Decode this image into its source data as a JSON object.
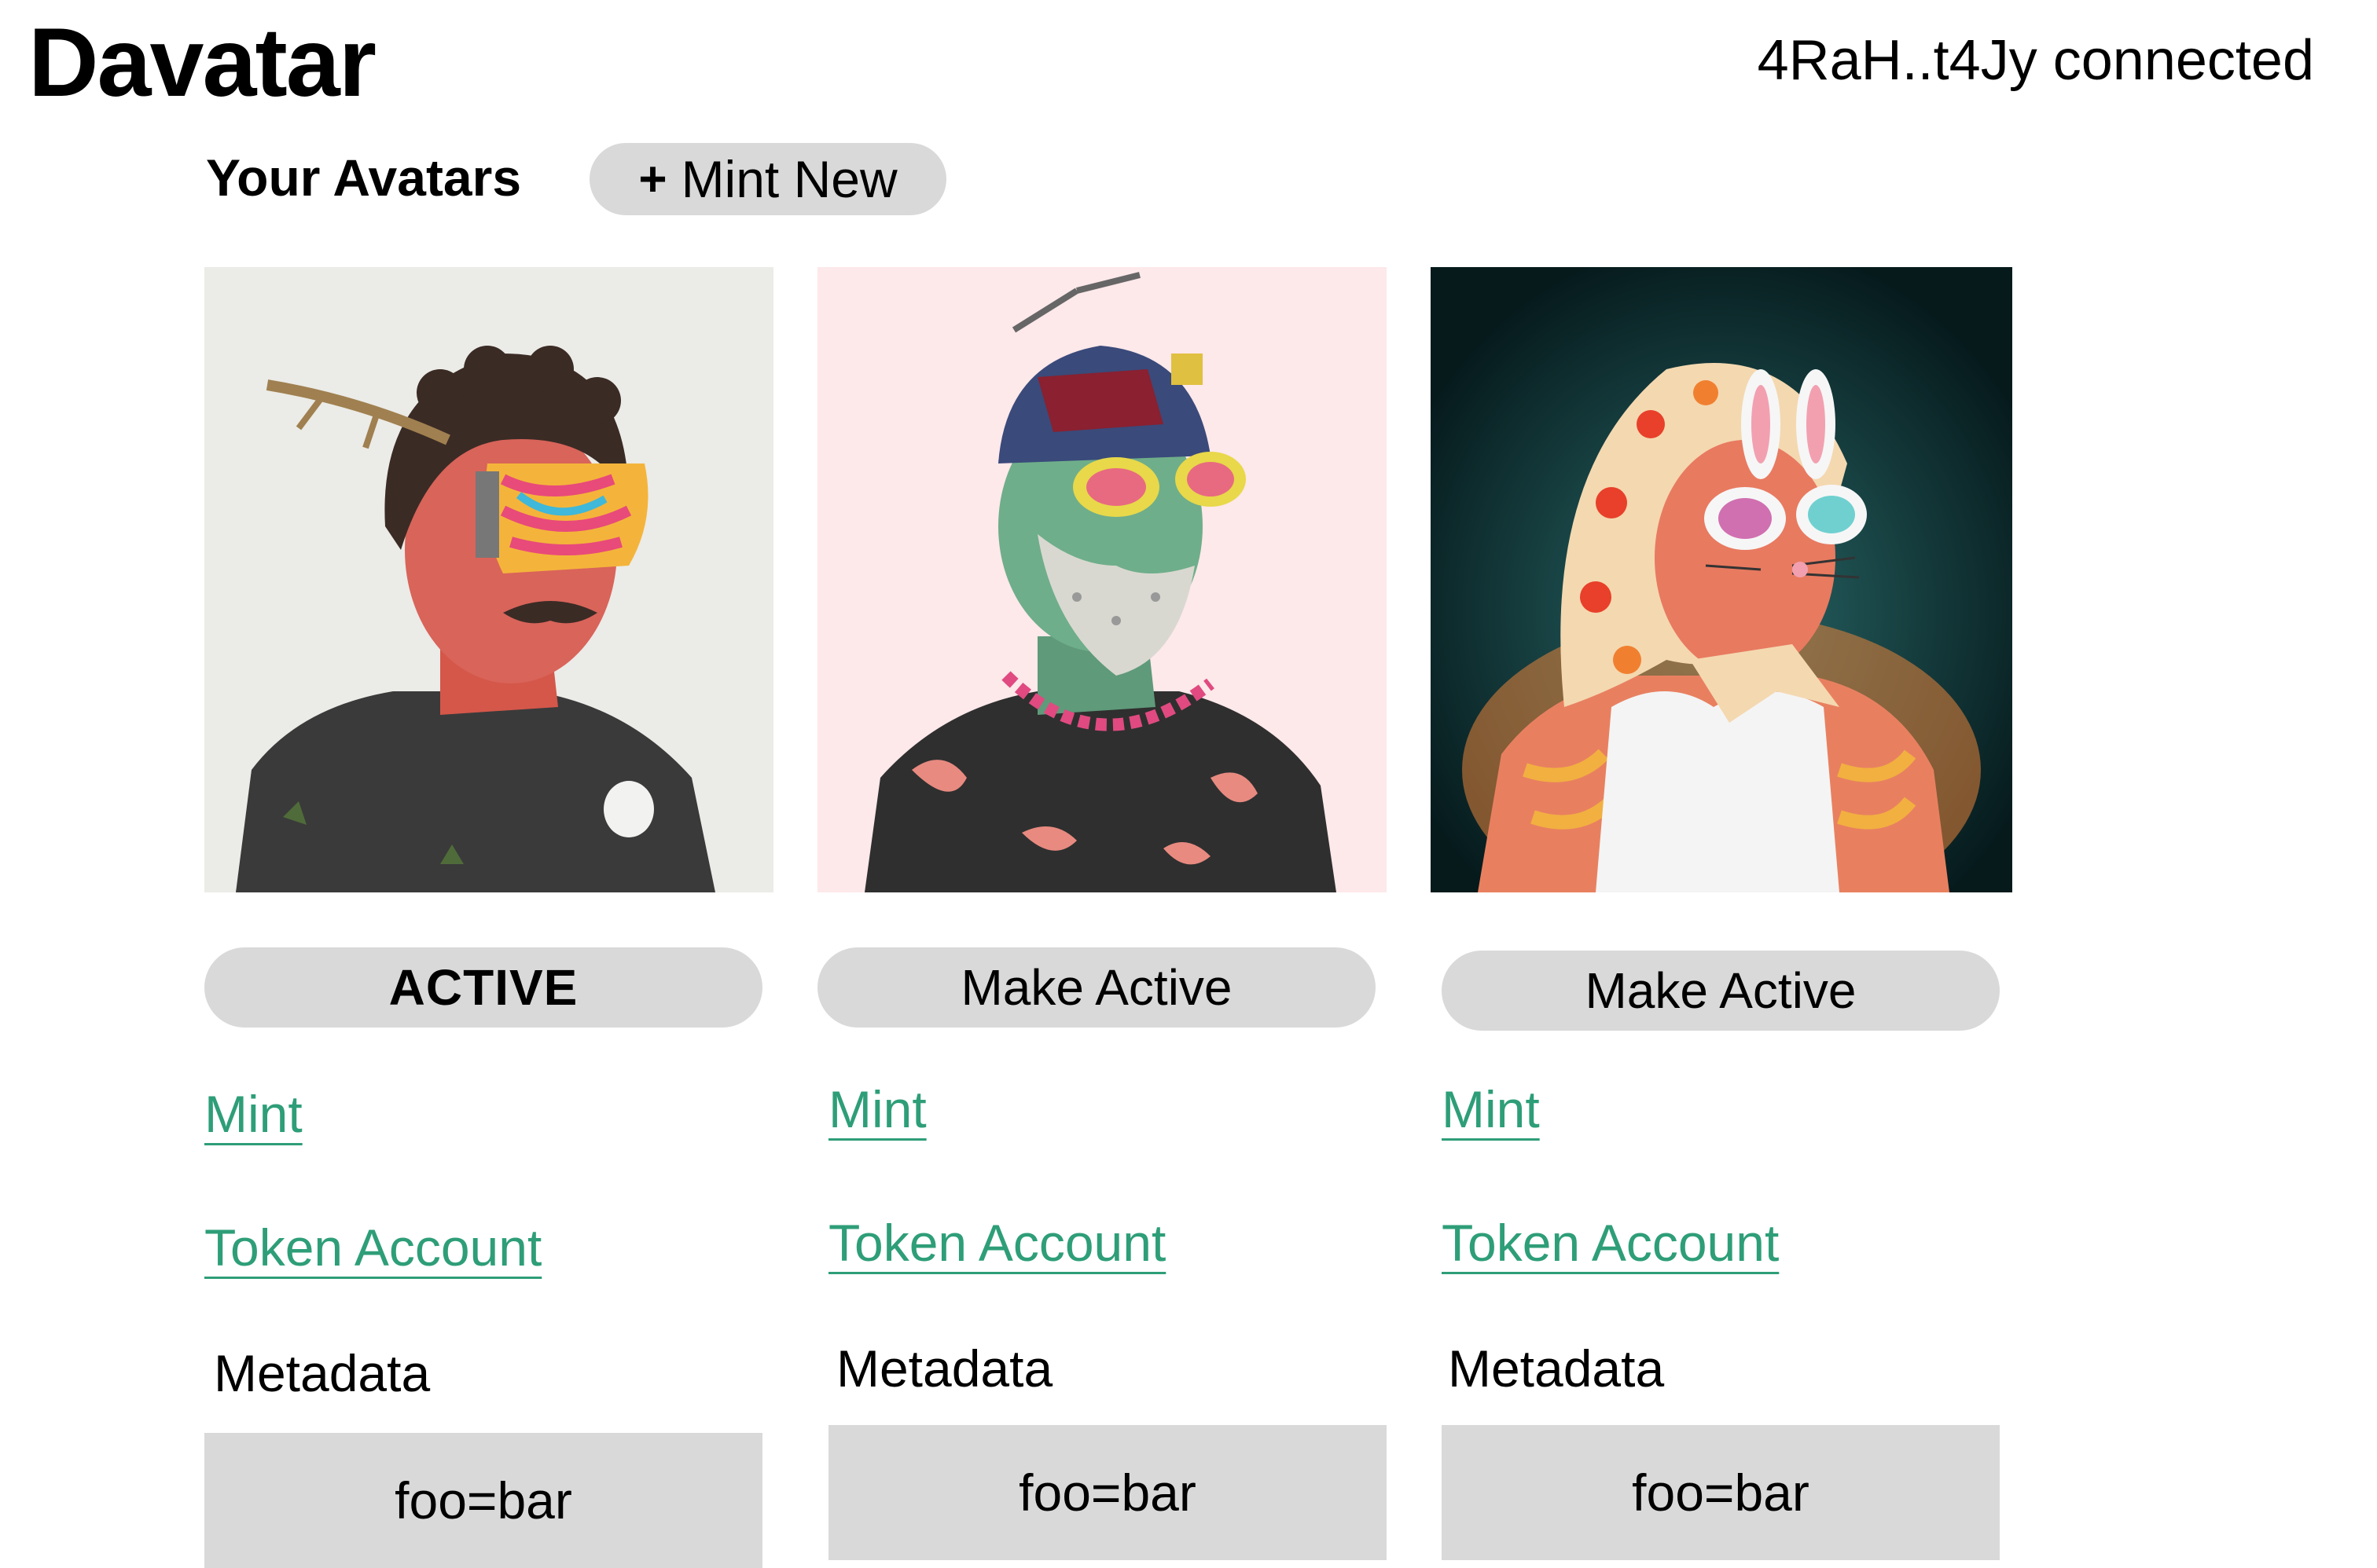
{
  "app": {
    "title": "Davatar",
    "wallet_status": "4RaH..t4Jy connected"
  },
  "section": {
    "title": "Your Avatars",
    "mint_new_icon": "plus-icon",
    "mint_new_label": "Mint New"
  },
  "avatars": [
    {
      "image_description_icon": "avatar-image",
      "button_label": "ACTIVE",
      "is_active": true,
      "mint_link": "Mint",
      "token_account_link": "Token Account",
      "metadata_label": "Metadata",
      "metadata_value": "foo=bar",
      "bg_color": "#ebebe7"
    },
    {
      "image_description_icon": "avatar-image",
      "button_label": "Make Active",
      "is_active": false,
      "mint_link": "Mint",
      "token_account_link": "Token Account",
      "metadata_label": "Metadata",
      "metadata_value": "foo=bar",
      "bg_color": "#fde8ea"
    },
    {
      "image_description_icon": "avatar-image",
      "button_label": "Make Active",
      "is_active": false,
      "mint_link": "Mint",
      "token_account_link": "Token Account",
      "metadata_label": "Metadata",
      "metadata_value": "foo=bar",
      "bg_color": "#0f3a3c"
    }
  ],
  "colors": {
    "link": "#2e9e78",
    "button_bg": "#d9d9d9",
    "metadata_bg": "#d9d9d9"
  }
}
